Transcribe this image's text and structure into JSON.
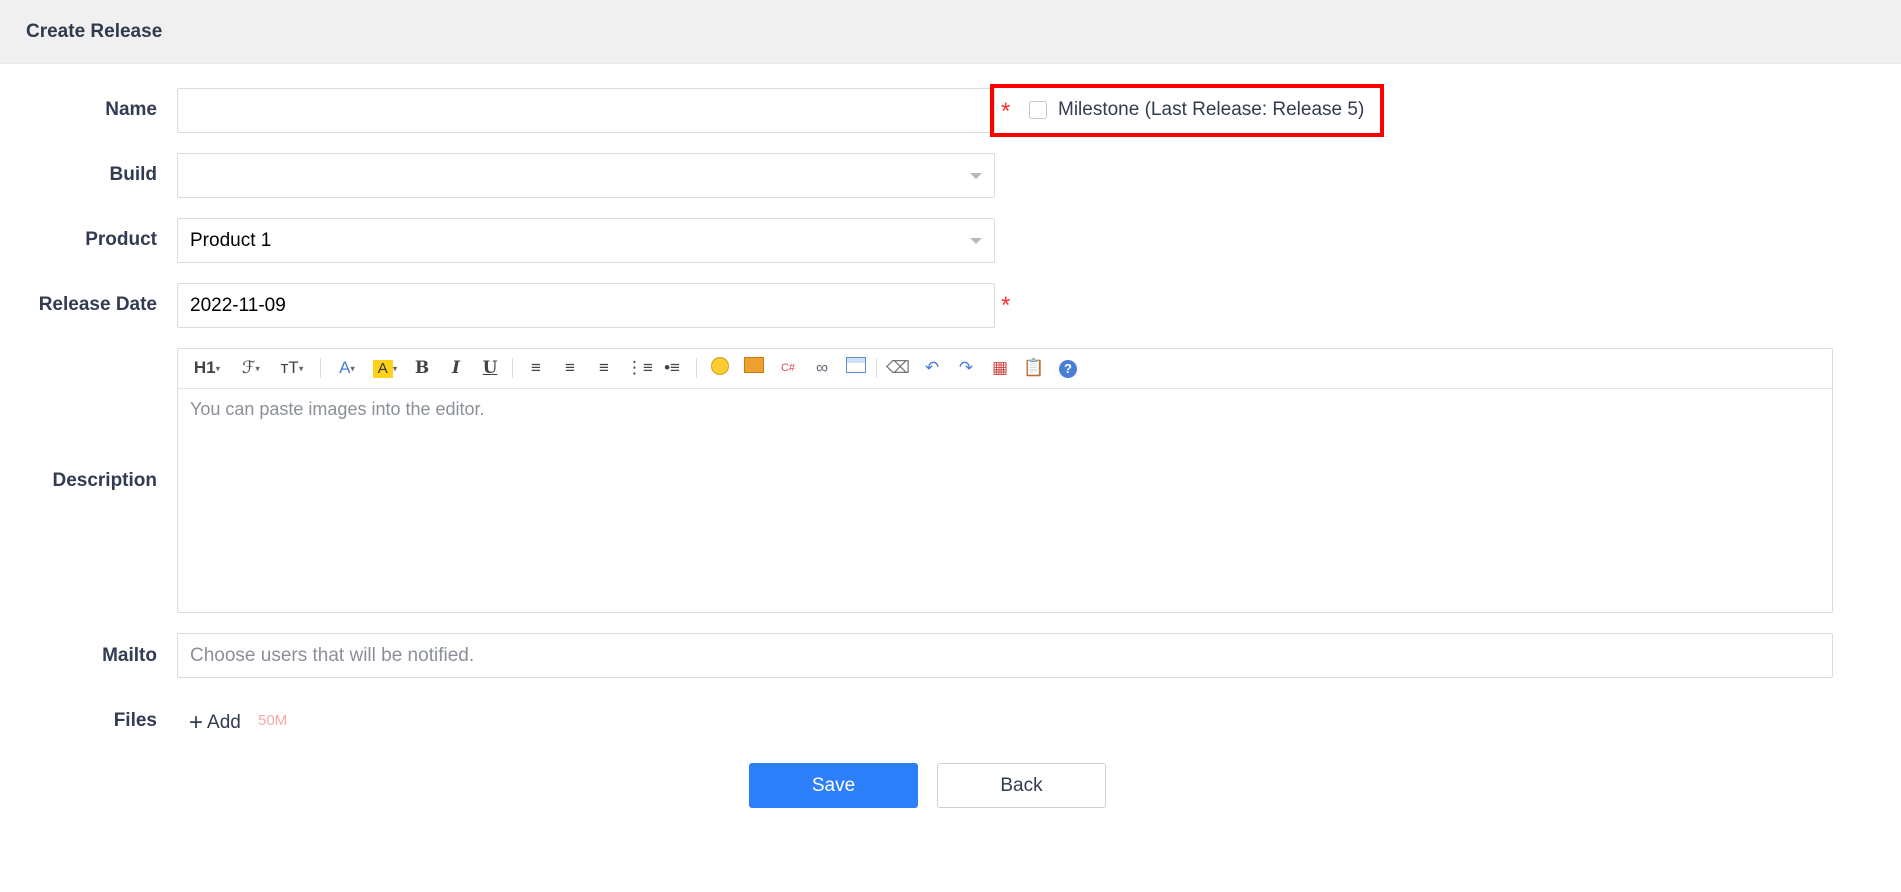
{
  "header": {
    "title": "Create Release"
  },
  "form": {
    "name": {
      "label": "Name",
      "value": ""
    },
    "milestone": {
      "label": "Milestone",
      "note": "(Last Release: Release 5)",
      "checked": false
    },
    "build": {
      "label": "Build",
      "value": ""
    },
    "product": {
      "label": "Product",
      "value": "Product 1"
    },
    "release_date": {
      "label": "Release Date",
      "value": "2022-11-09"
    },
    "description": {
      "label": "Description",
      "placeholder": "You can paste images into the editor."
    },
    "mailto": {
      "label": "Mailto",
      "placeholder": "Choose users that will be notified."
    },
    "files": {
      "label": "Files",
      "add_label": "Add",
      "size_limit": "50M"
    },
    "required_mark": "*"
  },
  "editor_toolbar": {
    "heading": "H1",
    "font_family": "ℱ",
    "font_size": "ᴛT",
    "font_color": "A",
    "highlight": "A",
    "bold": "B",
    "italic": "I",
    "underline": "U",
    "help": "?"
  },
  "actions": {
    "save": "Save",
    "back": "Back"
  },
  "colors": {
    "accent": "#2d7ff9",
    "required": "#ff2e2e",
    "highlight_box": "#ff0000"
  }
}
